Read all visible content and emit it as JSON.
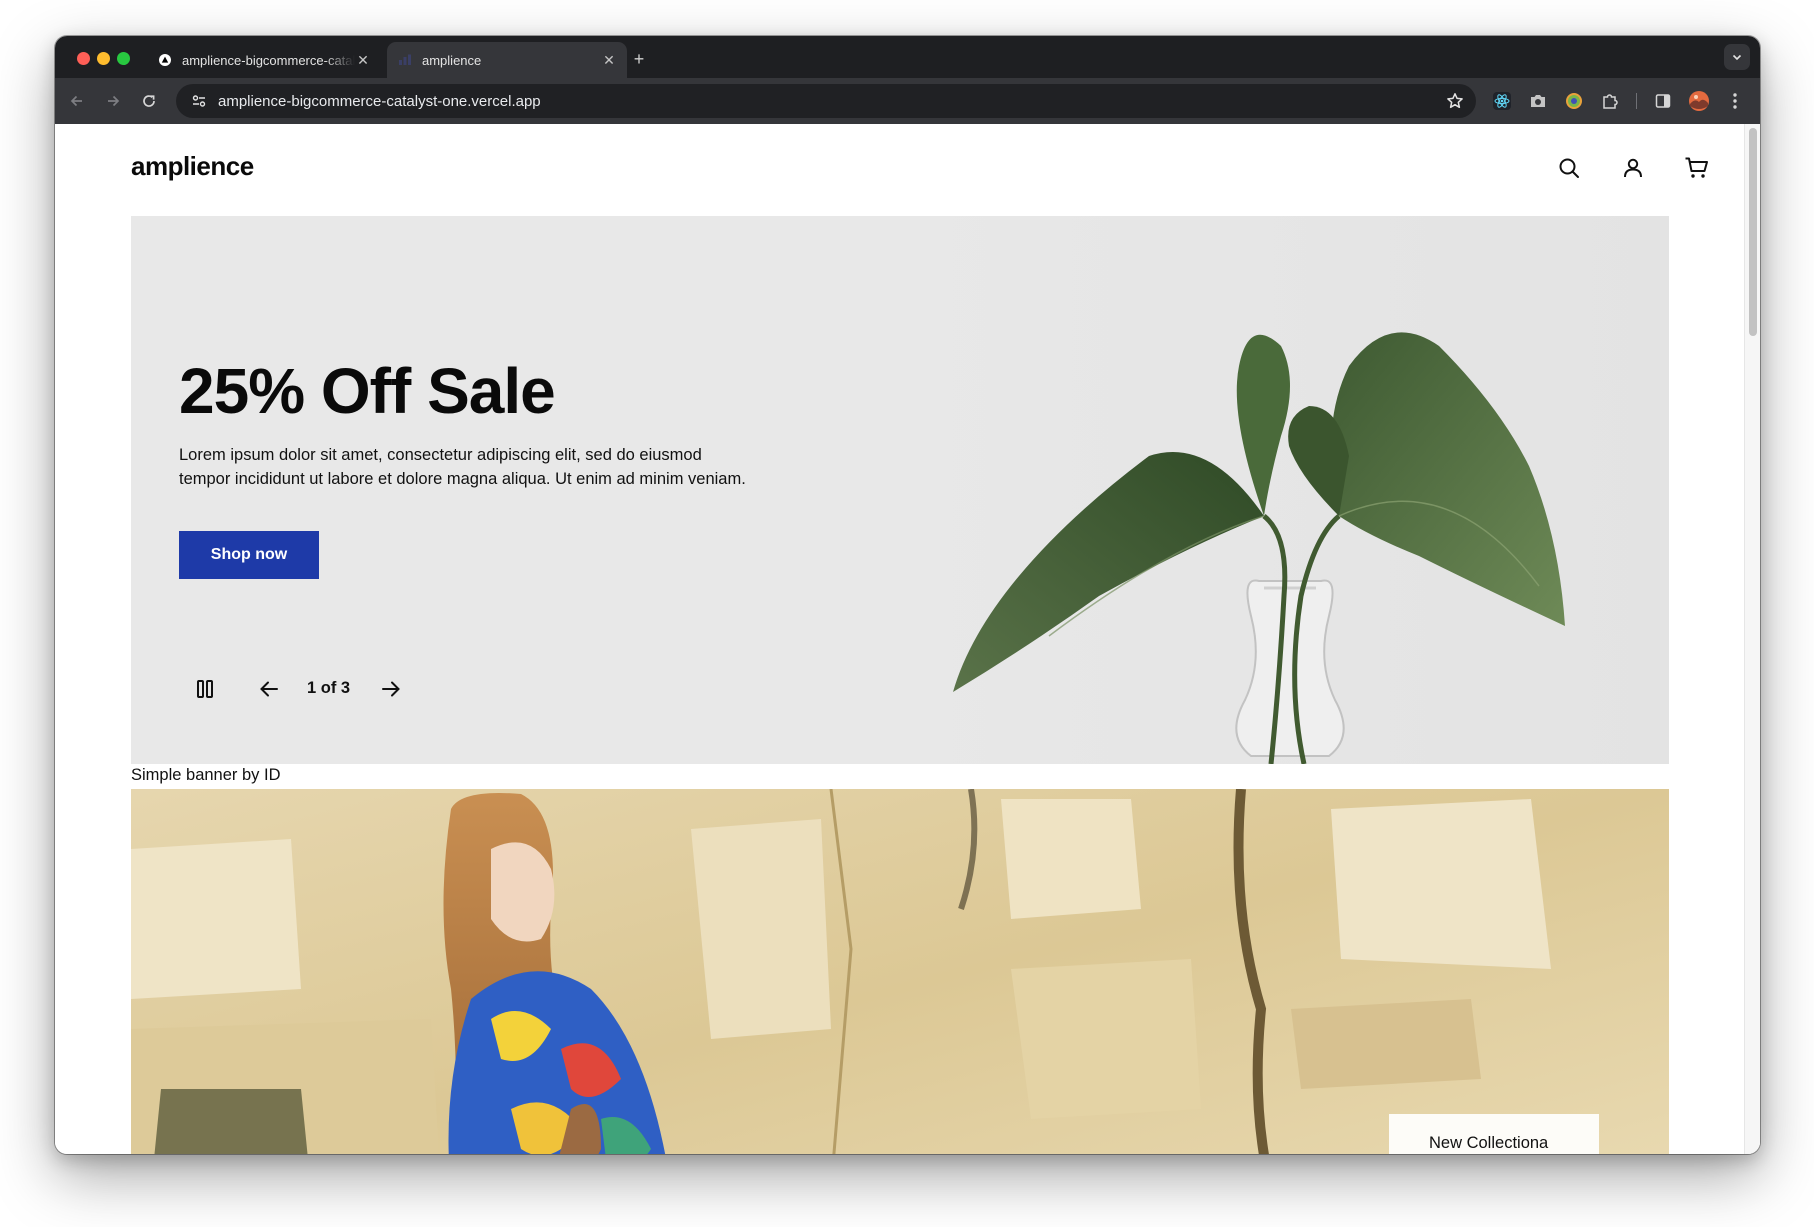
{
  "browser": {
    "tabs": [
      {
        "title": "amplience-bigcommerce-catalyst",
        "active": false,
        "favicon": "vercel-triangle-icon"
      },
      {
        "title": "amplience",
        "active": true,
        "favicon": "amplience-icon"
      }
    ],
    "close_glyph": "✕",
    "new_tab_glyph": "+",
    "address": "amplience-bigcommerce-catalyst-one.vercel.app"
  },
  "site": {
    "logo": "amplience",
    "header_icons": [
      "search-icon",
      "account-icon",
      "cart-icon"
    ]
  },
  "hero": {
    "title": "25% Off Sale",
    "body": "Lorem ipsum dolor sit amet, consectetur adipiscing elit, sed do eiusmod tempor incididunt ut labore et dolore magna aliqua. Ut enim ad minim veniam.",
    "button": "Shop now",
    "counter": "1 of 3",
    "background": "#e8e8e8",
    "button_color": "#1e3aa8"
  },
  "simple_banner": {
    "caption": "Simple banner by ID",
    "card_text": "New Collectiona"
  }
}
